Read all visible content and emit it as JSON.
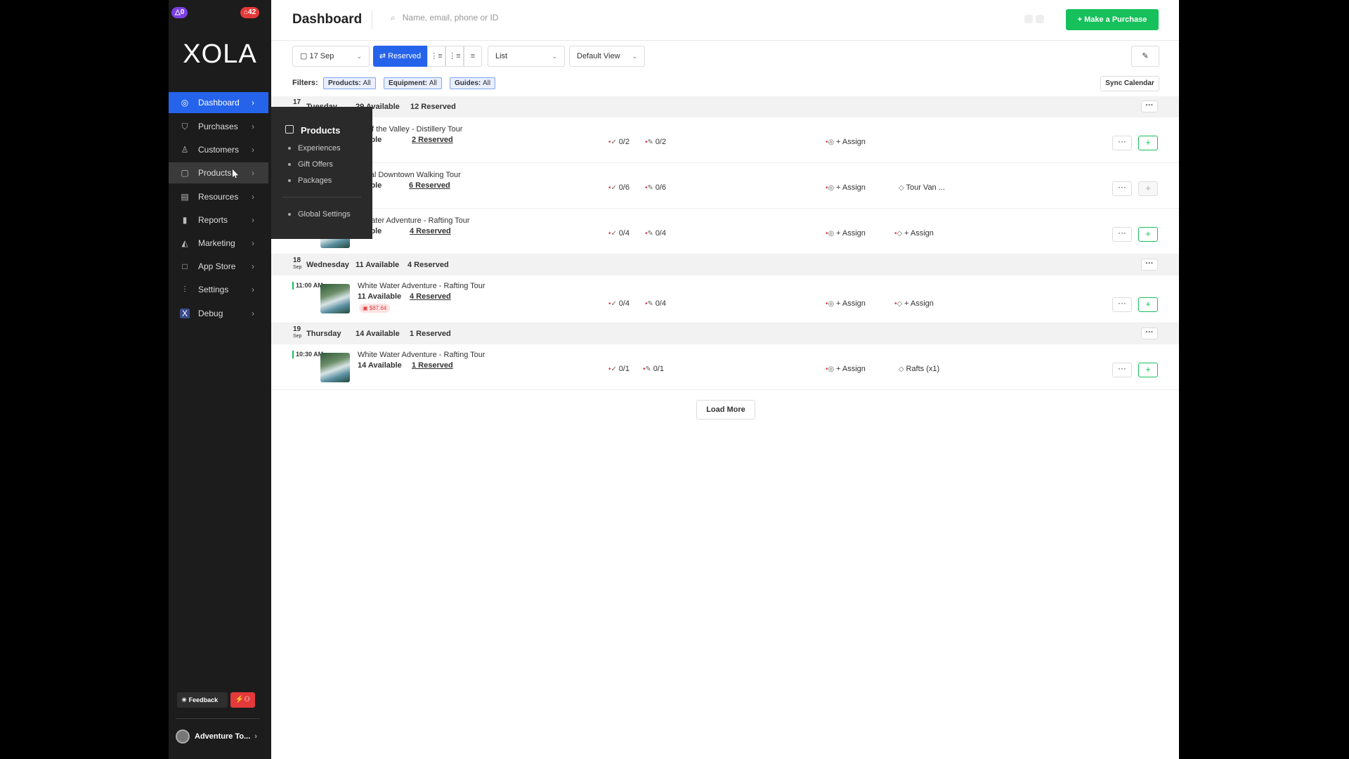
{
  "badges": {
    "left": "△0",
    "right": "⌂42"
  },
  "logo": "XOLA",
  "nav": [
    {
      "label": "Dashboard",
      "icon": "dashboard-icon"
    },
    {
      "label": "Purchases",
      "icon": "cart-icon"
    },
    {
      "label": "Customers",
      "icon": "users-icon"
    },
    {
      "label": "Products",
      "icon": "box-icon"
    },
    {
      "label": "Resources",
      "icon": "clipboard-icon"
    },
    {
      "label": "Reports",
      "icon": "bar-chart-icon"
    },
    {
      "label": "Marketing",
      "icon": "megaphone-icon"
    },
    {
      "label": "App Store",
      "icon": "square-icon"
    },
    {
      "label": "Settings",
      "icon": "sliders-icon"
    },
    {
      "label": "Debug",
      "icon": "x-icon"
    }
  ],
  "flyout": {
    "title": "Products",
    "items": [
      "Experiences",
      "Gift Offers",
      "Packages"
    ],
    "footer_item": "Global Settings"
  },
  "footer": {
    "feedback": "Feedback",
    "account": "Adventure To..."
  },
  "header": {
    "title": "Dashboard",
    "search_placeholder": "Name, email, phone or ID",
    "make_purchase": "+ Make a Purchase"
  },
  "toolbar": {
    "date": "▢ 17 Sep",
    "reserved": "⇄ Reserved",
    "view": "List",
    "default_view": "Default View"
  },
  "filters": {
    "label": "Filters:",
    "chips": [
      {
        "key": "Products:",
        "val": "All"
      },
      {
        "key": "Equipment:",
        "val": "All"
      },
      {
        "key": "Guides:",
        "val": "All"
      }
    ],
    "sync": "Sync Calendar"
  },
  "days": [
    {
      "day": "17",
      "month": "",
      "weekday": "Tuesday",
      "available": "29 Available",
      "reserved": "12 Reserved"
    },
    {
      "day": "18",
      "month": "Sep",
      "weekday": "Wednesday",
      "available": "11 Available",
      "reserved": "4 Reserved"
    },
    {
      "day": "19",
      "month": "Sep",
      "weekday": "Thursday",
      "available": "14 Available",
      "reserved": "1 Reserved"
    }
  ],
  "rows": [
    {
      "time": "",
      "name": "its of the Valley - Distillery Tour",
      "available": "ailable",
      "reserved": "2 Reserved",
      "checkin": "0/2",
      "waiver": "0/2",
      "guide": "+ Assign",
      "equipment": "",
      "due": ""
    },
    {
      "time": "",
      "name": "orical Downtown Walking Tour",
      "available": "ailable",
      "reserved": "6 Reserved",
      "checkin": "0/6",
      "waiver": "0/6",
      "guide": "+ Assign",
      "equipment": "Tour Van ...",
      "due": ""
    },
    {
      "time": "",
      "name": "e Water Adventure - Rafting Tour",
      "available": "ailable",
      "reserved": "4 Reserved",
      "checkin": "0/4",
      "waiver": "0/4",
      "guide": "+ Assign",
      "equipment": "+ Assign",
      "due": ""
    },
    {
      "time": "11:00 AM",
      "name": "White Water Adventure - Rafting Tour",
      "available": "11 Available",
      "reserved": "4 Reserved",
      "checkin": "0/4",
      "waiver": "0/4",
      "guide": "+ Assign",
      "equipment": "+ Assign",
      "due": "$87.64"
    },
    {
      "time": "10:30 AM",
      "name": "White Water Adventure - Rafting Tour",
      "available": "14 Available",
      "reserved": "1 Reserved",
      "checkin": "0/1",
      "waiver": "0/1",
      "guide": "+ Assign",
      "equipment": "Rafts (x1)",
      "due": ""
    }
  ],
  "load_more": "Load More",
  "colors": {
    "accent": "#2663eb",
    "primary": "#16c05a",
    "alert": "#e23b3b"
  }
}
